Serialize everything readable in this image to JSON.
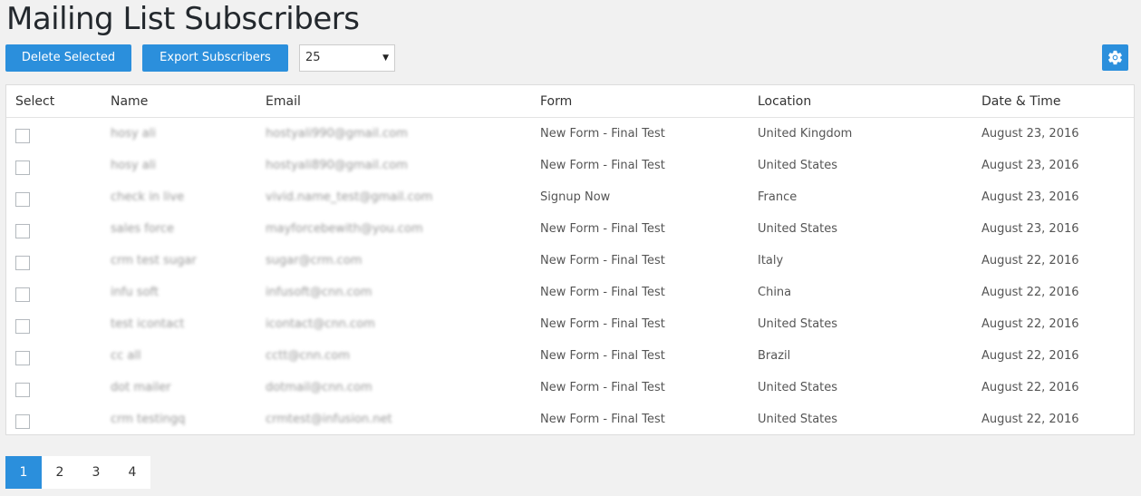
{
  "page_title": "Mailing List Subscribers",
  "toolbar": {
    "delete_label": "Delete Selected",
    "export_label": "Export Subscribers",
    "per_page_value": "25"
  },
  "settings_icon": "gear-icon",
  "accent_color": "#2b8fdc",
  "table": {
    "headers": [
      "Select",
      "Name",
      "Email",
      "Form",
      "Location",
      "Date & Time"
    ],
    "rows": [
      {
        "name": "hosy ali",
        "email": "hostyali990@gmail.com",
        "form": "New Form - Final Test",
        "location": "United Kingdom",
        "date": "August 23, 2016"
      },
      {
        "name": "hosy ali",
        "email": "hostyali890@gmail.com",
        "form": "New Form - Final Test",
        "location": "United States",
        "date": "August 23, 2016"
      },
      {
        "name": "check in live",
        "email": "vivid.name_test@gmail.com",
        "form": "Signup Now",
        "location": "France",
        "date": "August 23, 2016"
      },
      {
        "name": "sales force",
        "email": "mayforcebewith@you.com",
        "form": "New Form - Final Test",
        "location": "United States",
        "date": "August 23, 2016"
      },
      {
        "name": "crm test sugar",
        "email": "sugar@crm.com",
        "form": "New Form - Final Test",
        "location": "Italy",
        "date": "August 22, 2016"
      },
      {
        "name": "infu soft",
        "email": "infusoft@cnn.com",
        "form": "New Form - Final Test",
        "location": "China",
        "date": "August 22, 2016"
      },
      {
        "name": "test icontact",
        "email": "icontact@cnn.com",
        "form": "New Form - Final Test",
        "location": "United States",
        "date": "August 22, 2016"
      },
      {
        "name": "cc all",
        "email": "cctt@cnn.com",
        "form": "New Form - Final Test",
        "location": "Brazil",
        "date": "August 22, 2016"
      },
      {
        "name": "dot mailer",
        "email": "dotmail@cnn.com",
        "form": "New Form - Final Test",
        "location": "United States",
        "date": "August 22, 2016"
      },
      {
        "name": "crm testingq",
        "email": "crmtest@infusion.net",
        "form": "New Form - Final Test",
        "location": "United States",
        "date": "August 22, 2016"
      }
    ]
  },
  "pagination": {
    "pages": [
      "1",
      "2",
      "3",
      "4"
    ],
    "current": "1"
  }
}
